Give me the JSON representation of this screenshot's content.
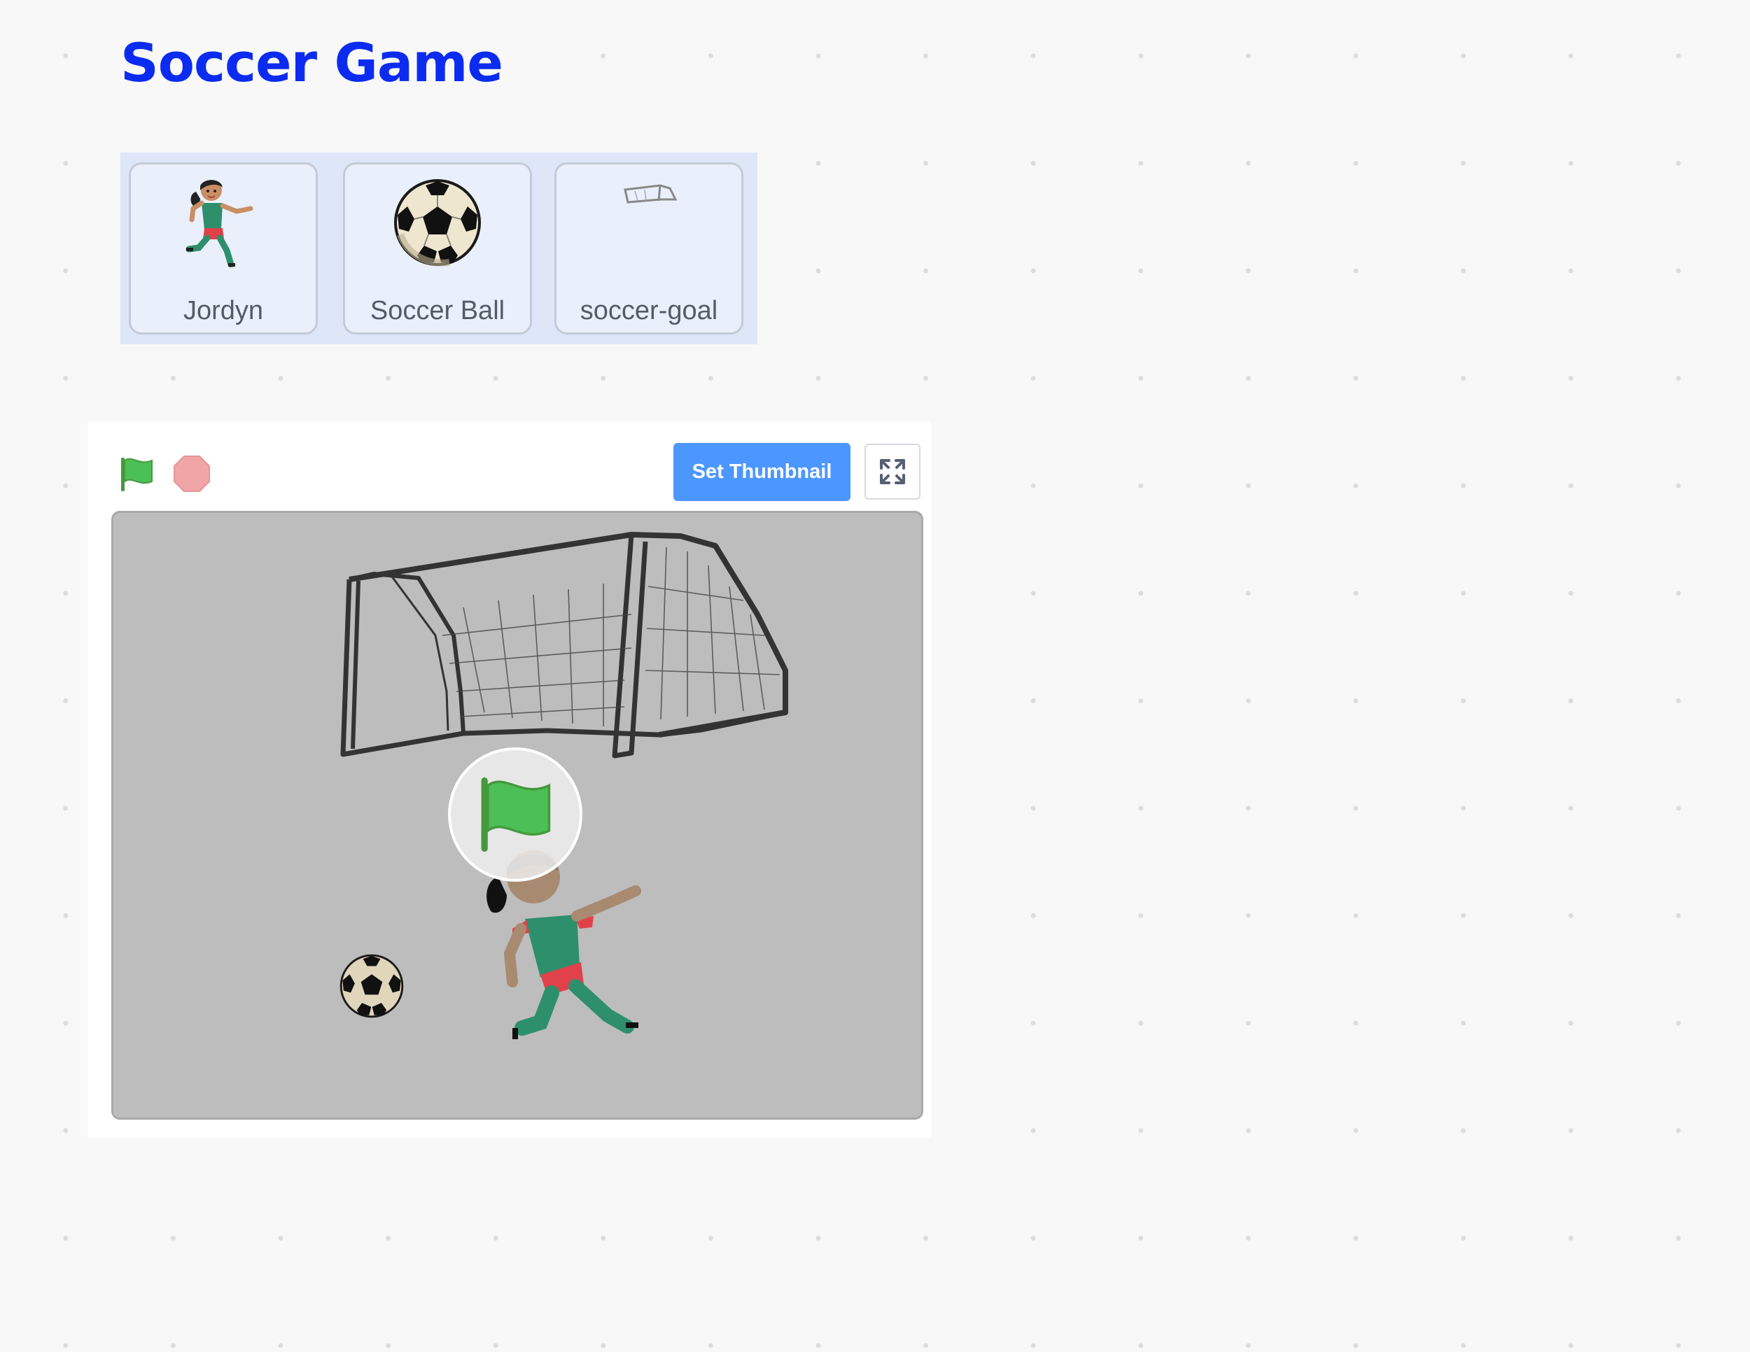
{
  "page": {
    "title": "Soccer Game"
  },
  "sprites": [
    {
      "name": "Jordyn",
      "icon": "player-sprite-icon"
    },
    {
      "name": "Soccer Ball",
      "icon": "soccer-ball-icon"
    },
    {
      "name": "soccer-goal",
      "icon": "soccer-goal-icon"
    }
  ],
  "stage_controls": {
    "green_flag_icon": "green-flag-icon",
    "stop_icon": "stop-sign-icon",
    "set_thumbnail_label": "Set Thumbnail",
    "fullscreen_icon": "fullscreen-icon"
  },
  "stage": {
    "overlay_icon": "green-flag-icon"
  },
  "colors": {
    "title": "#0b2cf0",
    "button": "#4c97ff",
    "green_flag": "#4cbf56",
    "stop": "#f0a6a6",
    "stage_background": "#bdbdbd",
    "sprite_tray": "#dde7f8"
  }
}
